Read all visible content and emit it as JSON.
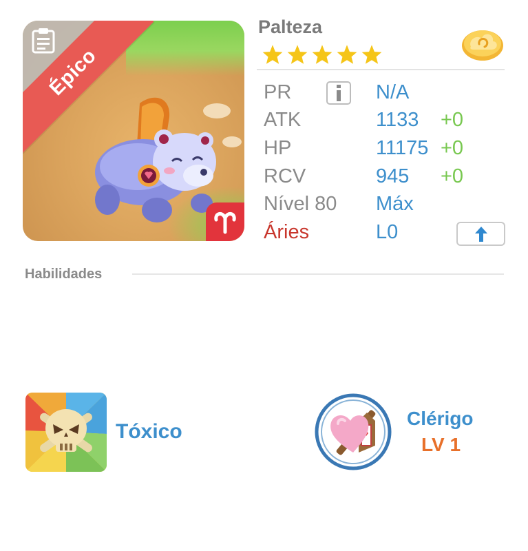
{
  "monster": {
    "name": "Palteza",
    "rarity": "Épico",
    "star_count": 5,
    "colors": {
      "rarity_ribbon": "#e85a54",
      "star": "#f5c518",
      "value_blue": "#3d8fcc",
      "bonus_green": "#78c850",
      "zodiac_red": "#c8362c",
      "level_orange": "#e8702a"
    }
  },
  "stats": {
    "pr": {
      "label": "PR",
      "value": "N/A"
    },
    "atk": {
      "label": "ATK",
      "value": "1133",
      "bonus": "+0"
    },
    "hp": {
      "label": "HP",
      "value": "11175",
      "bonus": "+0"
    },
    "rcv": {
      "label": "RCV",
      "value": "945",
      "bonus": "+0"
    },
    "level": {
      "label": "Nível 80",
      "value": "Máx"
    },
    "zodiac": {
      "label": "Áries",
      "value": "L0"
    }
  },
  "icons": {
    "info": "info-icon",
    "upgrade": "arrow-up-icon",
    "gold": "cloud-coin-icon",
    "notes": "clipboard-icon",
    "zodiac": "aries-icon"
  },
  "skills": {
    "section_title": "Habilidades",
    "ability": {
      "name": "Tóxico",
      "icon": "skull-icon"
    },
    "class": {
      "name": "Clérigo",
      "level": "LV 1",
      "icon": "heart-staff-icon"
    }
  }
}
